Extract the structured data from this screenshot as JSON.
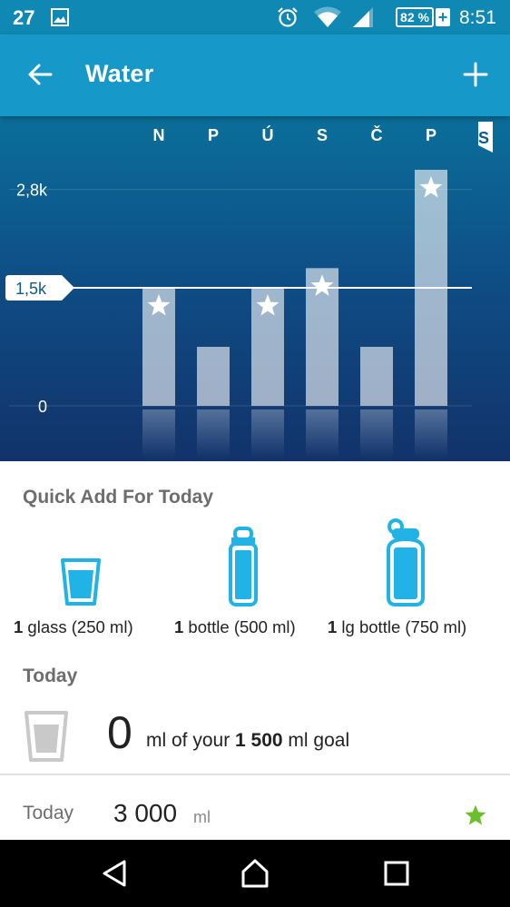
{
  "status_bar": {
    "notification_count": "27",
    "battery_percent": "82 %",
    "battery_plus": "+",
    "time": "8:51",
    "icons": [
      "image-icon",
      "alarm-icon",
      "wifi-icon",
      "signal-icon",
      "battery-icon"
    ]
  },
  "app_bar": {
    "title": "Water",
    "back_icon": "arrow-left-icon",
    "add_icon": "plus-icon"
  },
  "chart_data": {
    "type": "bar",
    "categories": [
      "N",
      "P",
      "Ú",
      "S",
      "Č",
      "P",
      "S"
    ],
    "values": [
      1500,
      750,
      1500,
      1750,
      750,
      3000,
      null
    ],
    "goal_met": [
      true,
      false,
      true,
      true,
      false,
      true,
      false
    ],
    "goal_line": 1500,
    "goal_label": "1,5k",
    "ytick_labels": [
      "0",
      "1,5k",
      "2,8k"
    ],
    "ytick_values": [
      0,
      1500,
      2750
    ],
    "ylim": [
      0,
      3000
    ],
    "bar_color": "rgba(255,255,255,0.6)",
    "marker_icon": "star-icon"
  },
  "quick_add": {
    "title": "Quick Add For Today",
    "items": [
      {
        "qty": "1",
        "label": " glass (250 ml)",
        "icon": "glass-icon"
      },
      {
        "qty": "1",
        "label": " bottle (500 ml)",
        "icon": "bottle-icon"
      },
      {
        "qty": "1",
        "label": " lg bottle (750 ml)",
        "icon": "large-bottle-icon"
      }
    ]
  },
  "today": {
    "title": "Today",
    "amount": "0",
    "goal_prefix": " ml of your ",
    "goal_value": "1 500",
    "goal_suffix": " ml goal",
    "icon": "empty-glass-icon"
  },
  "log": {
    "day": "Today",
    "value": "3 000",
    "unit": "ml",
    "icon": "star-icon"
  },
  "colors": {
    "accent": "#1699c9",
    "status_bar": "#0f88b4",
    "quick_add_icon": "#22b3e6",
    "star_green": "#6cbf2c"
  },
  "nav_bar": {
    "icons": [
      "back-triangle-icon",
      "home-icon",
      "recents-icon"
    ]
  }
}
